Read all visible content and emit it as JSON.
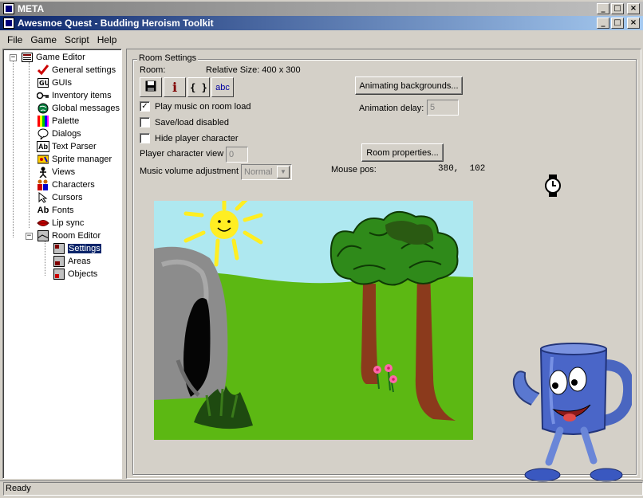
{
  "outer_window": {
    "title": "META"
  },
  "window": {
    "title": "Awesmoe Quest - Budding Heroism Toolkit"
  },
  "window_buttons": {
    "minimize": "_",
    "maximize": "□",
    "close": "×"
  },
  "menu": [
    {
      "label": "File"
    },
    {
      "label": "Game"
    },
    {
      "label": "Script"
    },
    {
      "label": "Help"
    }
  ],
  "tree": {
    "root": "Game Editor",
    "items": [
      {
        "label": "General settings",
        "icon": "checkmark-icon"
      },
      {
        "label": "GUIs",
        "icon": "gui-icon"
      },
      {
        "label": "Inventory items",
        "icon": "key-icon"
      },
      {
        "label": "Global messages",
        "icon": "globe-icon"
      },
      {
        "label": "Palette",
        "icon": "palette-icon"
      },
      {
        "label": "Dialogs",
        "icon": "speech-bubble-icon"
      },
      {
        "label": "Text Parser",
        "icon": "text-parser-icon"
      },
      {
        "label": "Sprite manager",
        "icon": "sprite-icon"
      },
      {
        "label": "Views",
        "icon": "views-icon"
      },
      {
        "label": "Characters",
        "icon": "characters-icon"
      },
      {
        "label": "Cursors",
        "icon": "cursor-icon"
      },
      {
        "label": "Fonts",
        "icon": "font-icon"
      },
      {
        "label": "Lip sync",
        "icon": "lips-icon"
      }
    ],
    "room_editor": {
      "label": "Room Editor",
      "children": [
        {
          "label": "Settings",
          "selected": true
        },
        {
          "label": "Areas"
        },
        {
          "label": "Objects"
        }
      ]
    },
    "fonts_icon_text": "Ab",
    "text_parser_icon_text": "Ab"
  },
  "room_settings": {
    "group_title": "Room Settings",
    "room_label": "Room:",
    "relative_size_label": "Relative Size: 400 x 300",
    "tools": [
      {
        "name": "save-tool-button",
        "icon": "floppy-disk-icon"
      },
      {
        "name": "info-tool-button",
        "icon": "info-icon",
        "text": "i"
      },
      {
        "name": "script-tool-button",
        "icon": "braces-icon",
        "text": "{ }"
      },
      {
        "name": "messages-tool-button",
        "icon": "text-icon",
        "text": "abc"
      }
    ],
    "checkboxes": [
      {
        "label": "Play music on room load",
        "checked": true
      },
      {
        "label": "Save/load disabled",
        "checked": false
      },
      {
        "label": "Hide player character",
        "checked": false
      }
    ],
    "player_view_label": "Player character view",
    "player_view_value": "0",
    "music_volume_label": "Music volume adjustment",
    "music_volume_value": "Normal",
    "animating_backgrounds_button": "Animating backgrounds...",
    "animation_delay_label": "Animation delay:",
    "animation_delay_value": "5",
    "room_properties_button": "Room properties...",
    "mouse_pos_label": "Mouse pos:",
    "mouse_pos_value": "380,  102"
  },
  "status": {
    "text": "Ready"
  },
  "colors": {
    "title_active": "#0a246a",
    "face": "#d4d0c8",
    "selection": "#0a246a",
    "sky": "#aee8f0",
    "grass": "#5cb813",
    "trunk": "#8b3a1c",
    "sun": "#ffee22"
  }
}
